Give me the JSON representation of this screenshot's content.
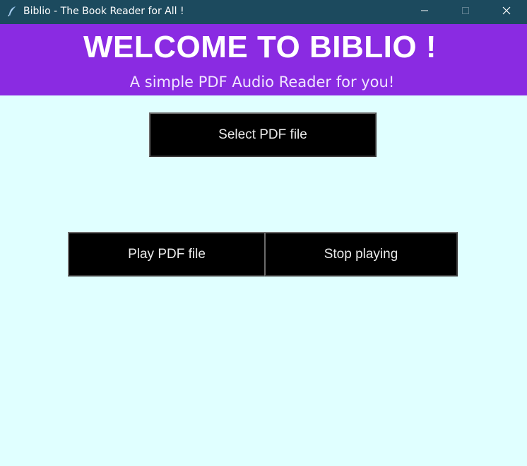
{
  "window": {
    "title": "Biblio - The Book Reader for All !",
    "app_icon": "feather-icon",
    "controls": {
      "minimize_icon": "minimize-icon",
      "maximize_icon": "maximize-icon",
      "close_icon": "close-icon"
    }
  },
  "banner": {
    "title": "WELCOME TO BIBLIO !",
    "subtitle": "A simple PDF Audio Reader for you!"
  },
  "buttons": {
    "select_label": "Select PDF file",
    "play_label": "Play PDF file",
    "stop_label": "Stop playing"
  },
  "colors": {
    "titlebar_bg": "#1c4a5e",
    "banner_bg": "#8a2be2",
    "page_bg": "#e0ffff",
    "button_bg": "#000000",
    "button_text": "#eaeaea"
  }
}
